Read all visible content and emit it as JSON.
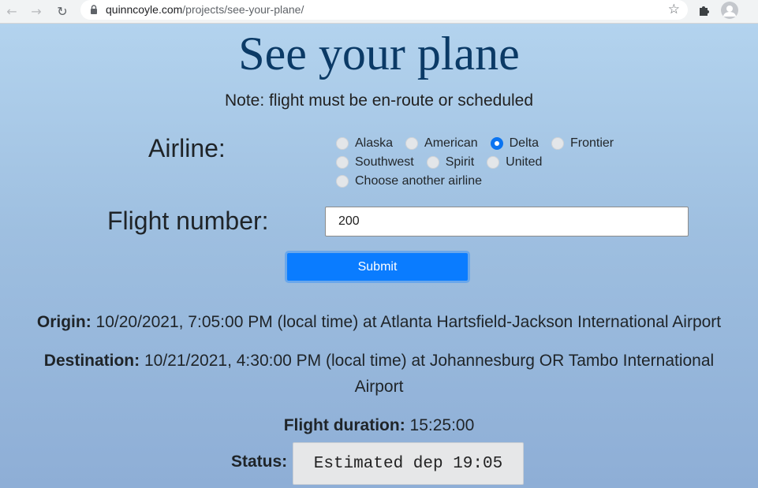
{
  "browser": {
    "url_host": "quinncoyle.com",
    "url_path": "/projects/see-your-plane/"
  },
  "page": {
    "title": "See your plane",
    "note": "Note: flight must be en-route or scheduled",
    "airline_label": "Airline:",
    "airlines": [
      {
        "label": "Alaska",
        "checked": false
      },
      {
        "label": "American",
        "checked": false
      },
      {
        "label": "Delta",
        "checked": true
      },
      {
        "label": "Frontier",
        "checked": false
      },
      {
        "label": "Southwest",
        "checked": false
      },
      {
        "label": "Spirit",
        "checked": false
      },
      {
        "label": "United",
        "checked": false
      },
      {
        "label": "Choose another airline",
        "checked": false
      }
    ],
    "flight_number_label": "Flight number:",
    "flight_number_value": "200",
    "submit_label": "Submit",
    "origin": {
      "label": "Origin:",
      "value": "10/20/2021, 7:05:00 PM (local time) at Atlanta Hartsfield-Jackson International Airport"
    },
    "destination": {
      "label": "Destination:",
      "value_line1": "10/21/2021, 4:30:00 PM (local time) at Johannesburg OR Tambo International",
      "value_line2": "Airport"
    },
    "duration": {
      "label": "Flight duration:",
      "value": "15:25:00"
    },
    "status": {
      "label": "Status:",
      "value": "Estimated dep 19:05"
    }
  },
  "colors": {
    "accent": "#0a7cff",
    "title": "#0b3a66"
  }
}
